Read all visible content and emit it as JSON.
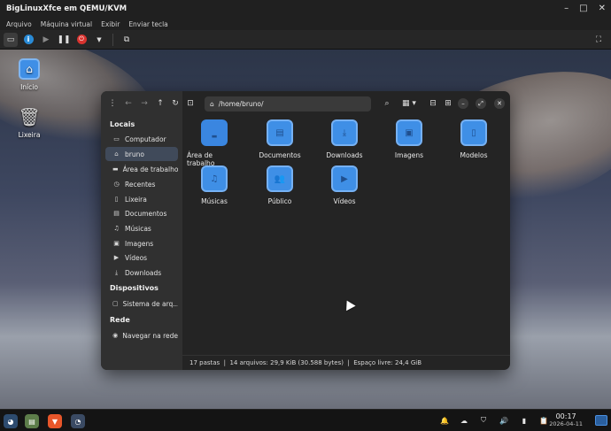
{
  "host": {
    "title": "BigLinuxXfce em QEMU/KVM",
    "menu": [
      "Arquivo",
      "Máquina virtual",
      "Exibir",
      "Enviar tecla"
    ],
    "controls": {
      "minimize": "–",
      "maximize": "□",
      "close": "✕"
    }
  },
  "desktop": {
    "icons": [
      {
        "label": "Início",
        "icon": "home-icon"
      },
      {
        "label": "Lixeira",
        "icon": "trash-icon"
      }
    ]
  },
  "filemanager": {
    "path": "/home/bruno/",
    "sidebar": {
      "sections": {
        "locais": "Locais",
        "dispositivos": "Dispositivos",
        "rede": "Rede"
      },
      "locais": [
        {
          "label": "Computador",
          "icon": "computer-icon"
        },
        {
          "label": "bruno",
          "icon": "home-icon",
          "active": true
        },
        {
          "label": "Área de trabalho",
          "icon": "desktop-icon"
        },
        {
          "label": "Recentes",
          "icon": "clock-icon"
        },
        {
          "label": "Lixeira",
          "icon": "trash-icon"
        },
        {
          "label": "Documentos",
          "icon": "document-icon"
        },
        {
          "label": "Músicas",
          "icon": "music-icon"
        },
        {
          "label": "Imagens",
          "icon": "image-icon"
        },
        {
          "label": "Vídeos",
          "icon": "video-icon"
        },
        {
          "label": "Downloads",
          "icon": "download-icon"
        }
      ],
      "dispositivos": [
        {
          "label": "Sistema de arq...",
          "icon": "drive-icon"
        }
      ],
      "rede": [
        {
          "label": "Navegar na rede",
          "icon": "network-icon"
        }
      ]
    },
    "folders": [
      {
        "label": "Área de trabalho",
        "icon": "desktop-folder-icon"
      },
      {
        "label": "Documentos",
        "icon": "documents-folder-icon"
      },
      {
        "label": "Downloads",
        "icon": "downloads-folder-icon"
      },
      {
        "label": "Imagens",
        "icon": "images-folder-icon"
      },
      {
        "label": "Modelos",
        "icon": "templates-folder-icon"
      },
      {
        "label": "Músicas",
        "icon": "music-folder-icon"
      },
      {
        "label": "Público",
        "icon": "public-folder-icon"
      },
      {
        "label": "Vídeos",
        "icon": "videos-folder-icon"
      }
    ],
    "status": "17 pastas  |  14 arquivos: 29,9 KiB (30.588 bytes)  |  Espaço livre: 24,4 GiB"
  },
  "taskbar": {
    "clock": {
      "time": "00:17",
      "date": "2026-04-11"
    }
  },
  "colors": {
    "accent": "#3f8fe6",
    "window_bg": "#242424",
    "sidebar_bg": "#303030"
  }
}
